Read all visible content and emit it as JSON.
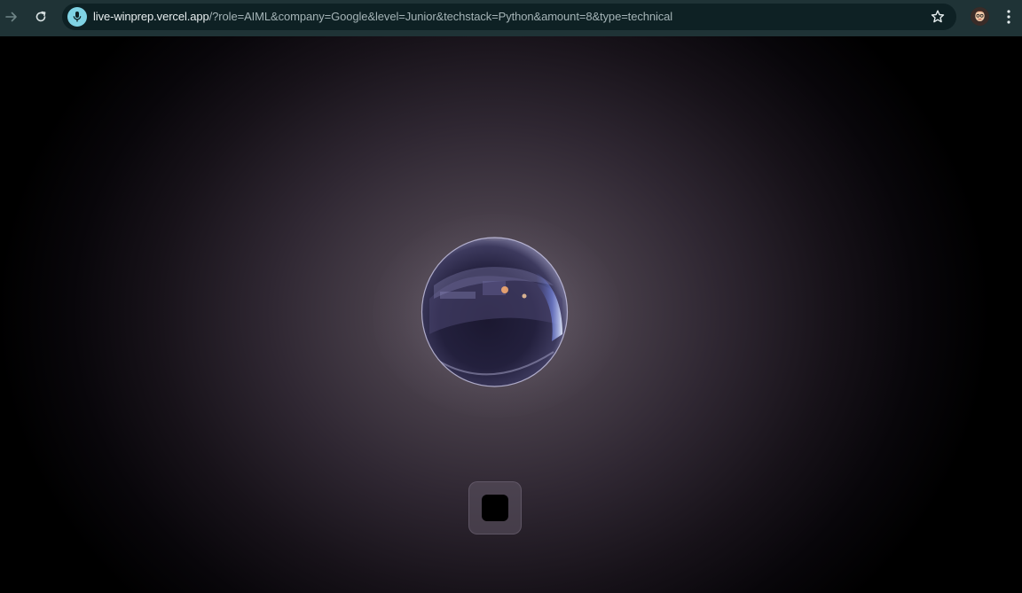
{
  "browser": {
    "url_host": "live-winprep.vercel.app",
    "url_path": "/?role=AIML&company=Google&level=Junior&techstack=Python&amount=8&type=technical",
    "icons": {
      "forward": "arrow-right-icon",
      "reload": "reload-icon",
      "site_info": "microphone-icon",
      "bookmark": "star-icon",
      "profile": "avatar",
      "menu": "kebab-menu-icon"
    }
  },
  "page": {
    "orb": "sphere-orb",
    "controls": {
      "stop_icon": "stop-icon"
    }
  },
  "colors": {
    "toolbar": "#1f3336",
    "address_bar": "#0e2124",
    "site_info_badge": "#7fd3e4",
    "background_center": "#5f5560",
    "background_edge": "#000000"
  }
}
